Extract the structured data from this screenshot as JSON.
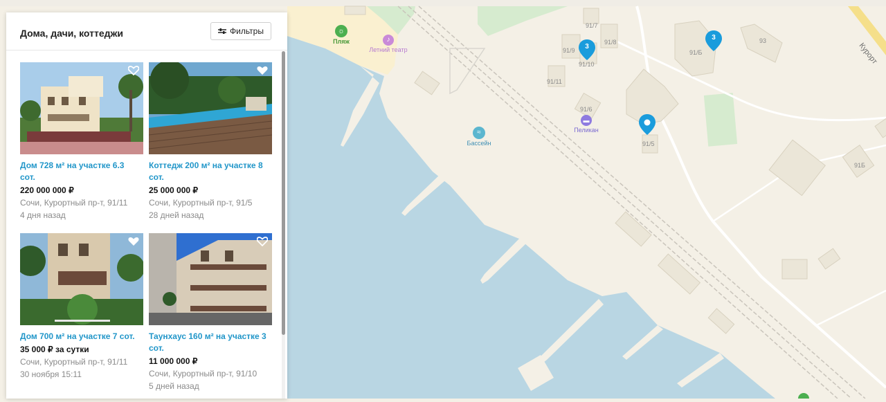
{
  "panel": {
    "title": "Дома, дачи, коттеджи",
    "filter_label": "Фильтры"
  },
  "listings": [
    {
      "title_line1": "Дом 728 м² на участке 6.3",
      "title_line2": "сот.",
      "price": "220 000 000 ₽",
      "address": "Сочи, Курортный пр-т, 91/11",
      "date": "4 дня назад"
    },
    {
      "title_line1": "Коттедж 200 м² на участке 8",
      "title_line2": "сот.",
      "price": "25 000 000 ₽",
      "address": "Сочи, Курортный пр-т, 91/5",
      "date": "28 дней назад"
    },
    {
      "title_line1": "Дом 700 м² на участке 7 сот.",
      "title_line2": "",
      "price": "35 000 ₽ за сутки",
      "address": "Сочи, Курортный пр-т, 91/11",
      "date": "30 ноября 15:11"
    },
    {
      "title_line1": "Таунхаус 160 м² на участке 3",
      "title_line2": "сот.",
      "price": "11 000 000 ₽",
      "address": "Сочи, Курортный пр-т, 91/10",
      "date": "5 дней назад"
    }
  ],
  "map": {
    "pois": {
      "beach": "Пляж",
      "summer_theater": "Летний театр",
      "pool": "Бассейн",
      "pelican": "Пеликан"
    },
    "buildings": [
      "91/7",
      "91/9",
      "91/8",
      "91/10",
      "91/11",
      "91/6",
      "91/5",
      "91/Б",
      "93",
      "91Б"
    ],
    "street_partial": "Курорт",
    "cluster_counts": [
      "3",
      "3"
    ]
  },
  "colors": {
    "accent": "#2196c9",
    "water": "#b9d6e3",
    "land": "#f4f0e6",
    "pin": "#1a9cdc"
  }
}
